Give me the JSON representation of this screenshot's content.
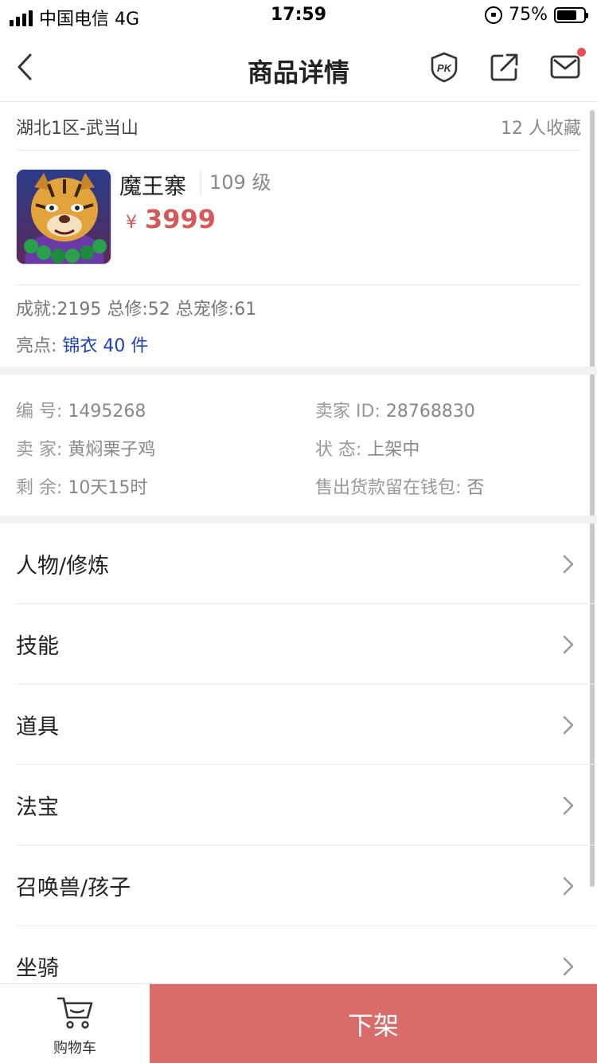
{
  "status_bar": {
    "carrier": "中国电信 4G",
    "time": "17:59",
    "battery_pct": "75%",
    "battery_level": 0.75
  },
  "navbar": {
    "title": "商品详情",
    "pk_icon": "pk-icon",
    "share_icon": "share-icon",
    "mail_icon": "mail-icon",
    "has_unread": true
  },
  "server": {
    "name": "湖北1区-武当山",
    "favorites": "12 人收藏"
  },
  "item": {
    "name": "魔王寨",
    "level": "109 级",
    "currency": "¥",
    "price": "3999"
  },
  "stats": {
    "summary": "成就:2195 总修:52 总宠修:61",
    "highlight_label": "亮点:",
    "highlight_value": "锦衣 40 件"
  },
  "info": {
    "serial_label": "编 号:",
    "serial_value": "1495268",
    "seller_id_label": "卖家 ID:",
    "seller_id_value": "28768830",
    "seller_label": "卖 家:",
    "seller_value": "黄焖栗子鸡",
    "status_label": "状 态:",
    "status_value": "上架中",
    "remaining_label": "剩 余:",
    "remaining_value": "10天15时",
    "wallet_label": "售出货款留在钱包:",
    "wallet_value": "否"
  },
  "menu": [
    {
      "label": "人物/修炼"
    },
    {
      "label": "技能"
    },
    {
      "label": "道具"
    },
    {
      "label": "法宝"
    },
    {
      "label": "召唤兽/孩子"
    },
    {
      "label": "坐骑"
    }
  ],
  "bottom": {
    "cart_label": "购物车",
    "action_label": "下架"
  },
  "colors": {
    "price": "#d45a5a",
    "highlight": "#1d3fb8",
    "action": "#d96b68"
  }
}
